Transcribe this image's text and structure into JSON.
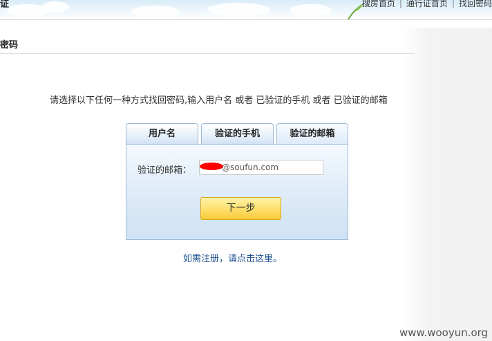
{
  "header": {
    "title": "证",
    "links": [
      "搜房首页",
      "通行证首页",
      "找回密码"
    ],
    "separator": "|"
  },
  "section": {
    "title": "密码"
  },
  "instruction": "请选择以下任何一种方式找回密码,输入用户名 或者 已验证的手机 或者 已验证的邮箱",
  "tabs": [
    {
      "label": "用户名",
      "active": false
    },
    {
      "label": "验证的手机",
      "active": false
    },
    {
      "label": "验证的邮箱",
      "active": true
    }
  ],
  "form": {
    "email_label": "验证的邮箱：",
    "email_value": "@soufun.com",
    "next_button": "下一步"
  },
  "register_link": "如需注册，请点击这里。",
  "watermark": "www.wooyun.org",
  "colors": {
    "link": "#1a4f8c",
    "panel_border": "#9cb9d6",
    "button_yellow": "#fde070",
    "redaction": "#ff0000"
  }
}
